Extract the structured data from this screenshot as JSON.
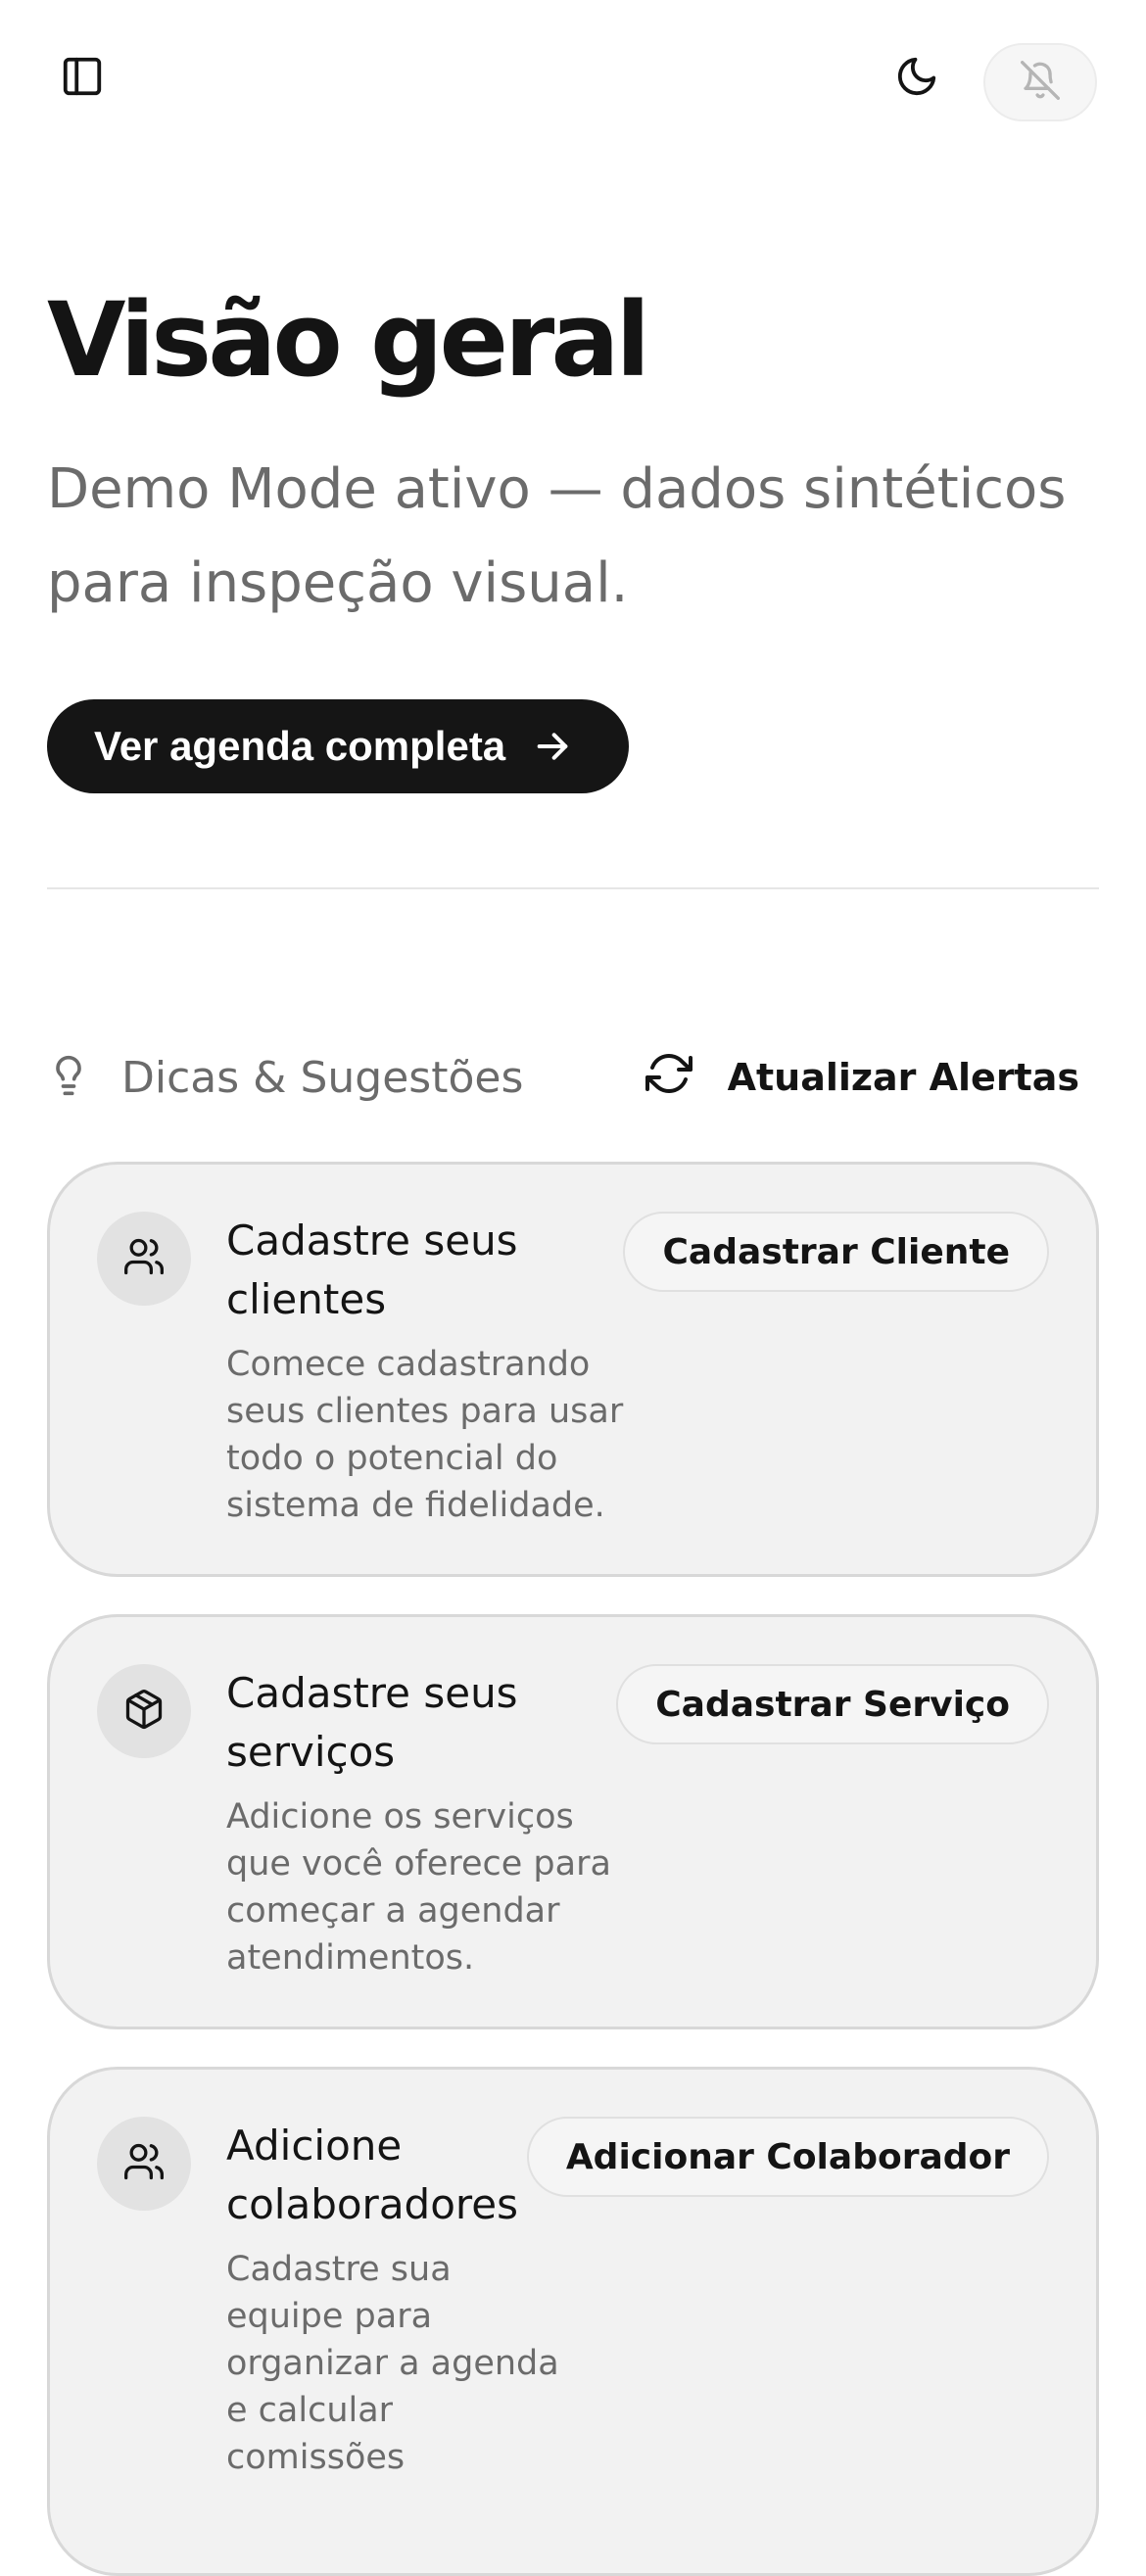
{
  "header": {
    "sidebar_icon": "panel-left-icon",
    "theme_icon": "moon-icon",
    "notifications_icon": "bell-off-icon"
  },
  "hero": {
    "title": "Visão geral",
    "subtitle": "Demo Mode ativo — dados sintéticos para inspeção visual.",
    "cta_label": "Ver agenda completa",
    "cta_icon": "arrow-right-icon"
  },
  "tips": {
    "title": "Dicas & Sugestões",
    "title_icon": "lightbulb-icon",
    "refresh_label": "Atualizar Alertas",
    "refresh_icon": "refresh-icon",
    "cards": [
      {
        "icon": "users-icon",
        "title_line1": "Cadastre seus",
        "title_line2": "clientes",
        "desc": [
          "Comece cadastrando",
          "seus clientes para usar",
          "todo o potencial do",
          "sistema de fidelidade."
        ],
        "action": "Cadastrar Cliente"
      },
      {
        "icon": "package-icon",
        "title_line1": "Cadastre seus",
        "title_line2": "serviços",
        "desc": [
          "Adicione os serviços",
          "que você oferece para",
          "começar a agendar",
          "atendimentos."
        ],
        "action": "Cadastrar Serviço"
      },
      {
        "icon": "users-icon",
        "title_line1": "Adicione",
        "title_line2": "colaboradores",
        "desc": [
          "Cadastre sua",
          "equipe para",
          "organizar a agenda",
          "e calcular",
          "comissões"
        ],
        "action": "Adicionar Colaborador"
      }
    ]
  },
  "colors": {
    "primary": "#151515",
    "muted_text": "#6b6b6b",
    "card_bg": "#f2f2f2",
    "card_border": "#d8d8d8"
  }
}
